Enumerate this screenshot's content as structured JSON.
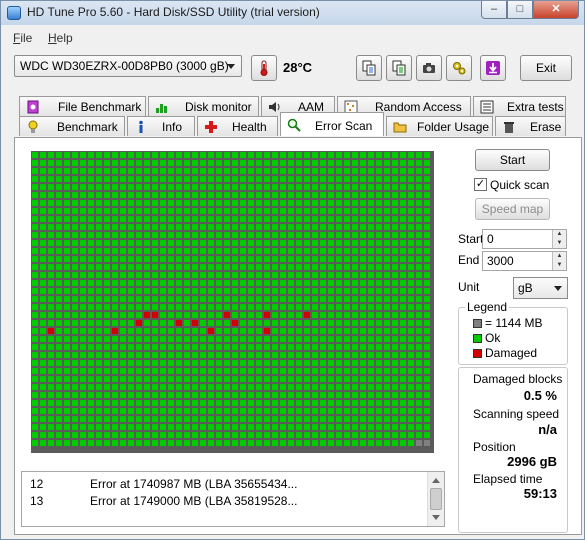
{
  "window": {
    "title": "HD Tune Pro 5.60 - Hard Disk/SSD Utility (trial version)"
  },
  "menu": {
    "file": "File",
    "help": "Help"
  },
  "toolbar": {
    "drive": "WDC WD30EZRX-00D8PB0 (3000 gB)",
    "temperature": "28°C",
    "exit_label": "Exit",
    "icons": [
      "thermometer-icon",
      "copy-info-icon",
      "copy-text-icon",
      "screenshot-icon",
      "settings-icon",
      "save-icon"
    ]
  },
  "tabs_top": [
    "File Benchmark",
    "Disk monitor",
    "AAM",
    "Random Access",
    "Extra tests"
  ],
  "tabs_bottom": [
    "Benchmark",
    "Info",
    "Health",
    "Error Scan",
    "Folder Usage",
    "Erase"
  ],
  "active_tab": "Error Scan",
  "scan": {
    "start_label": "Start",
    "quick_scan_label": "Quick scan",
    "quick_scan_checked": true,
    "speed_map_label": "Speed map",
    "start_field_label": "Start",
    "start_value": "0",
    "end_field_label": "End",
    "end_value": "3000",
    "unit_label": "Unit",
    "unit_value": "gB"
  },
  "legend": {
    "title": "Legend",
    "block_size": "= 1144 MB",
    "ok": "Ok",
    "damaged": "Damaged",
    "colors": {
      "ok": "#00cc00",
      "damaged": "#d40000",
      "block": "#808080"
    }
  },
  "stats": {
    "damaged_blocks_label": "Damaged blocks",
    "damaged_blocks_value": "0.5 %",
    "scanning_speed_label": "Scanning speed",
    "scanning_speed_value": "n/a",
    "position_label": "Position",
    "position_value": "2996 gB",
    "elapsed_label": "Elapsed time",
    "elapsed_value": "59:13"
  },
  "grid": {
    "cols": 50,
    "rows": 37,
    "damaged_cells": [
      [
        2,
        22
      ],
      [
        10,
        22
      ],
      [
        13,
        21
      ],
      [
        14,
        20
      ],
      [
        15,
        20
      ],
      [
        18,
        21
      ],
      [
        20,
        21
      ],
      [
        22,
        22
      ],
      [
        24,
        20
      ],
      [
        25,
        21
      ],
      [
        29,
        20
      ],
      [
        29,
        22
      ],
      [
        34,
        20
      ]
    ],
    "unscanned_cells": [
      [
        49,
        36
      ],
      [
        48,
        36
      ]
    ]
  },
  "log": [
    {
      "num": "12",
      "msg": "Error at 1740987 MB (LBA 35655434..."
    },
    {
      "num": "13",
      "msg": "Error at 1749000 MB (LBA 35819528..."
    }
  ]
}
